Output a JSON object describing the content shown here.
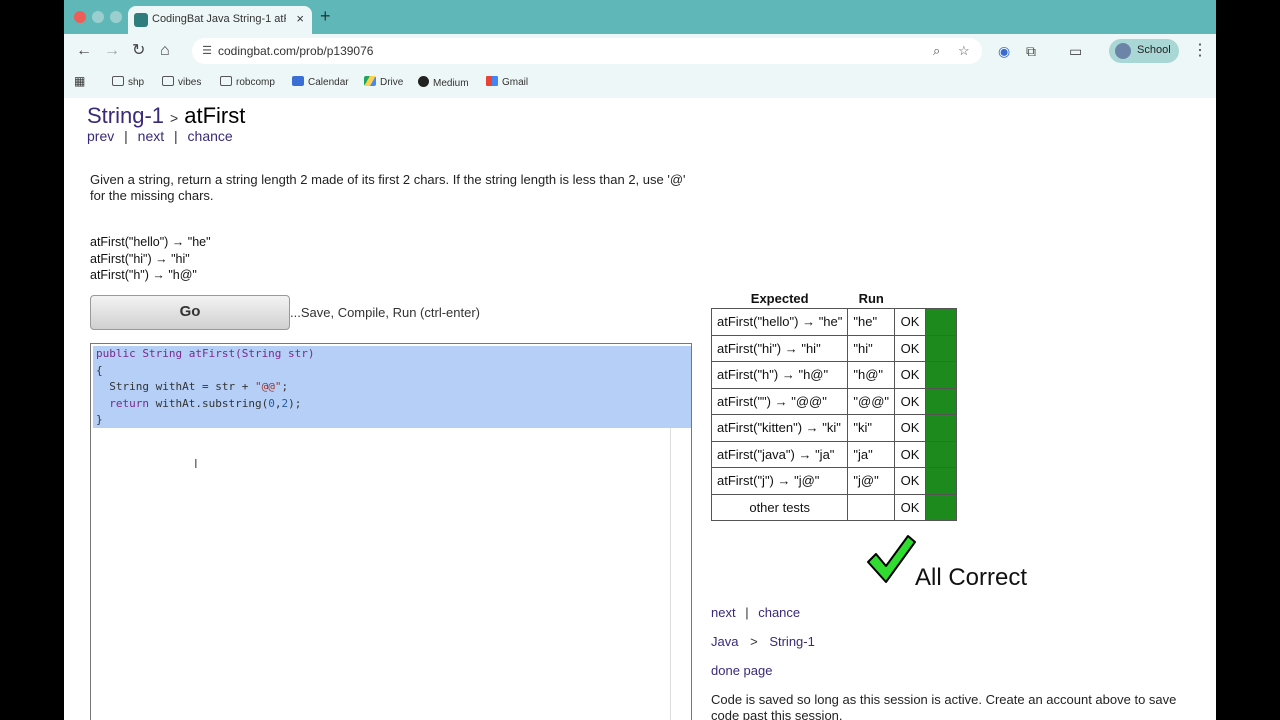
{
  "browser": {
    "tab_title": "CodingBat Java String-1 atFirst",
    "new_tab": "+",
    "tab_close": "×",
    "url": "codingbat.com/prob/p139076",
    "profile_label": "School",
    "bookmarks": [
      "shp",
      "vibes",
      "robcomp",
      "Calendar",
      "Drive",
      "Medium",
      "Gmail"
    ]
  },
  "page": {
    "breadcrumb_section": "String-1",
    "breadcrumb_sep": ">",
    "breadcrumb_problem": "atFirst",
    "nav_prev": "prev",
    "nav_next": "next",
    "nav_chance": "chance",
    "nav_sep": "|",
    "description": "Given a string, return a string length 2 made of its first 2 chars. If the string length is less than 2, use '@' for the missing chars.",
    "examples": [
      "atFirst(\"hello\") → \"he\"",
      "atFirst(\"hi\") → \"hi\"",
      "atFirst(\"h\") → \"h@\""
    ],
    "go_label": "Go",
    "go_hint": "...Save, Compile, Run (ctrl-enter)",
    "code": {
      "line1_kw": "public String atFirst(String str)",
      "line2": "{",
      "line3_a": "  String withAt = str + ",
      "line3_str": "\"@@\"",
      "line3_b": ";",
      "line4_kw": "  return",
      "line4_a": " withAt.substring(",
      "line4_n1": "0",
      "line4_c": ",",
      "line4_n2": "2",
      "line4_d": ");",
      "line5": "}"
    }
  },
  "results": {
    "header_expected": "Expected",
    "header_run": "Run",
    "rows": [
      {
        "expected": "atFirst(\"hello\") → \"he\"",
        "run": "\"he\"",
        "status": "OK"
      },
      {
        "expected": "atFirst(\"hi\") → \"hi\"",
        "run": "\"hi\"",
        "status": "OK"
      },
      {
        "expected": "atFirst(\"h\") → \"h@\"",
        "run": "\"h@\"",
        "status": "OK"
      },
      {
        "expected": "atFirst(\"\") → \"@@\"",
        "run": "\"@@\"",
        "status": "OK"
      },
      {
        "expected": "atFirst(\"kitten\") → \"ki\"",
        "run": "\"ki\"",
        "status": "OK"
      },
      {
        "expected": "atFirst(\"java\") → \"ja\"",
        "run": "\"ja\"",
        "status": "OK"
      },
      {
        "expected": "atFirst(\"j\") → \"j@\"",
        "run": "\"j@\"",
        "status": "OK"
      },
      {
        "expected": "other tests",
        "run": "",
        "status": "OK"
      }
    ],
    "pass_color": "#1c8a1c",
    "all_correct": "All Correct"
  },
  "footer": {
    "next": "next",
    "sep": "|",
    "chance": "chance",
    "lang": "Java",
    "lang_sep": ">",
    "section": "String-1",
    "done": "done page",
    "saved_note": "Code is saved so long as this session is active. Create an account above to save code past this session."
  }
}
